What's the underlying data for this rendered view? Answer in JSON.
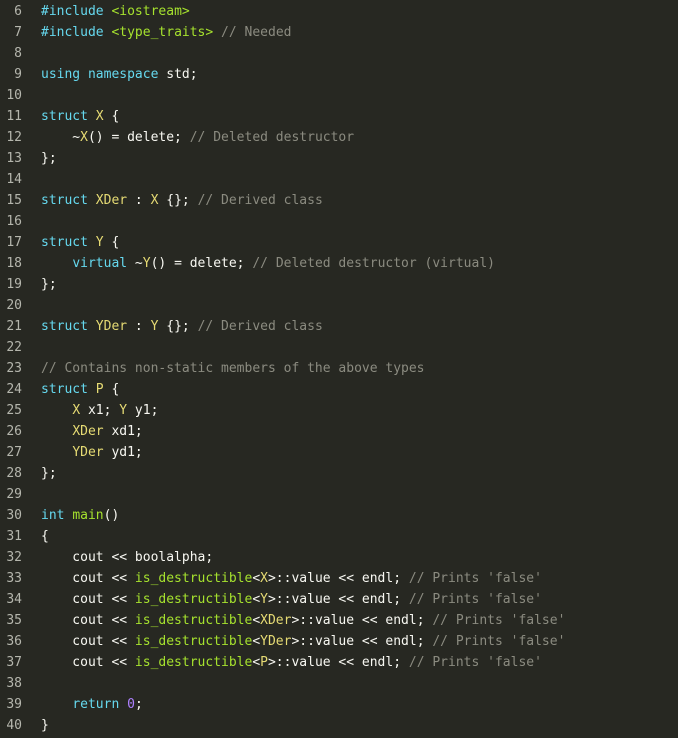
{
  "editor": {
    "lines": [
      {
        "num": "6",
        "tokens": [
          {
            "t": "#include ",
            "c": "pp"
          },
          {
            "t": "<iostream>",
            "c": "inc"
          }
        ]
      },
      {
        "num": "7",
        "tokens": [
          {
            "t": "#include ",
            "c": "pp"
          },
          {
            "t": "<type_traits>",
            "c": "inc"
          },
          {
            "t": " // Needed",
            "c": "cm"
          }
        ]
      },
      {
        "num": "8",
        "tokens": []
      },
      {
        "num": "9",
        "tokens": [
          {
            "t": "using",
            "c": "kw"
          },
          {
            "t": " ",
            "c": "pl"
          },
          {
            "t": "namespace",
            "c": "kw"
          },
          {
            "t": " std;",
            "c": "pl"
          }
        ]
      },
      {
        "num": "10",
        "tokens": []
      },
      {
        "num": "11",
        "tokens": [
          {
            "t": "struct",
            "c": "kw"
          },
          {
            "t": " ",
            "c": "pl"
          },
          {
            "t": "X",
            "c": "cls"
          },
          {
            "t": " {",
            "c": "pl"
          }
        ]
      },
      {
        "num": "12",
        "tokens": [
          {
            "t": "    ~",
            "c": "pl"
          },
          {
            "t": "X",
            "c": "cls"
          },
          {
            "t": "() = delete; ",
            "c": "pl"
          },
          {
            "t": "// Deleted destructor",
            "c": "cm"
          }
        ]
      },
      {
        "num": "13",
        "tokens": [
          {
            "t": "};",
            "c": "pl"
          }
        ]
      },
      {
        "num": "14",
        "tokens": []
      },
      {
        "num": "15",
        "tokens": [
          {
            "t": "struct",
            "c": "kw"
          },
          {
            "t": " ",
            "c": "pl"
          },
          {
            "t": "XDer",
            "c": "cls"
          },
          {
            "t": " : ",
            "c": "pl"
          },
          {
            "t": "X",
            "c": "cls"
          },
          {
            "t": " {}; ",
            "c": "pl"
          },
          {
            "t": "// Derived class",
            "c": "cm"
          }
        ]
      },
      {
        "num": "16",
        "tokens": []
      },
      {
        "num": "17",
        "tokens": [
          {
            "t": "struct",
            "c": "kw"
          },
          {
            "t": " ",
            "c": "pl"
          },
          {
            "t": "Y",
            "c": "cls"
          },
          {
            "t": " {",
            "c": "pl"
          }
        ]
      },
      {
        "num": "18",
        "tokens": [
          {
            "t": "    ",
            "c": "pl"
          },
          {
            "t": "virtual",
            "c": "kw"
          },
          {
            "t": " ~",
            "c": "pl"
          },
          {
            "t": "Y",
            "c": "cls"
          },
          {
            "t": "() = delete; ",
            "c": "pl"
          },
          {
            "t": "// Deleted destructor (virtual)",
            "c": "cm"
          }
        ]
      },
      {
        "num": "19",
        "tokens": [
          {
            "t": "};",
            "c": "pl"
          }
        ]
      },
      {
        "num": "20",
        "tokens": []
      },
      {
        "num": "21",
        "tokens": [
          {
            "t": "struct",
            "c": "kw"
          },
          {
            "t": " ",
            "c": "pl"
          },
          {
            "t": "YDer",
            "c": "cls"
          },
          {
            "t": " : ",
            "c": "pl"
          },
          {
            "t": "Y",
            "c": "cls"
          },
          {
            "t": " {}; ",
            "c": "pl"
          },
          {
            "t": "// Derived class",
            "c": "cm"
          }
        ]
      },
      {
        "num": "22",
        "tokens": []
      },
      {
        "num": "23",
        "tokens": [
          {
            "t": "// Contains non-static members of the above types",
            "c": "cm"
          }
        ]
      },
      {
        "num": "24",
        "tokens": [
          {
            "t": "struct",
            "c": "kw"
          },
          {
            "t": " ",
            "c": "pl"
          },
          {
            "t": "P",
            "c": "cls"
          },
          {
            "t": " {",
            "c": "pl"
          }
        ]
      },
      {
        "num": "25",
        "tokens": [
          {
            "t": "    ",
            "c": "pl"
          },
          {
            "t": "X",
            "c": "cls"
          },
          {
            "t": " x1; ",
            "c": "pl"
          },
          {
            "t": "Y",
            "c": "cls"
          },
          {
            "t": " y1;",
            "c": "pl"
          }
        ]
      },
      {
        "num": "26",
        "tokens": [
          {
            "t": "    ",
            "c": "pl"
          },
          {
            "t": "XDer",
            "c": "cls"
          },
          {
            "t": " xd1;",
            "c": "pl"
          }
        ]
      },
      {
        "num": "27",
        "tokens": [
          {
            "t": "    ",
            "c": "pl"
          },
          {
            "t": "YDer",
            "c": "cls"
          },
          {
            "t": " yd1;",
            "c": "pl"
          }
        ]
      },
      {
        "num": "28",
        "tokens": [
          {
            "t": "};",
            "c": "pl"
          }
        ]
      },
      {
        "num": "29",
        "tokens": []
      },
      {
        "num": "30",
        "tokens": [
          {
            "t": "int",
            "c": "kw"
          },
          {
            "t": " ",
            "c": "pl"
          },
          {
            "t": "main",
            "c": "fn"
          },
          {
            "t": "()",
            "c": "pl"
          }
        ]
      },
      {
        "num": "31",
        "tokens": [
          {
            "t": "{",
            "c": "pl"
          }
        ]
      },
      {
        "num": "32",
        "tokens": [
          {
            "t": "    cout << boolalpha;",
            "c": "pl"
          }
        ]
      },
      {
        "num": "33",
        "tokens": [
          {
            "t": "    cout << ",
            "c": "pl"
          },
          {
            "t": "is_destructible",
            "c": "fn"
          },
          {
            "t": "<",
            "c": "pl"
          },
          {
            "t": "X",
            "c": "cls"
          },
          {
            "t": ">::value << endl; ",
            "c": "pl"
          },
          {
            "t": "// Prints 'false'",
            "c": "cm"
          }
        ]
      },
      {
        "num": "34",
        "tokens": [
          {
            "t": "    cout << ",
            "c": "pl"
          },
          {
            "t": "is_destructible",
            "c": "fn"
          },
          {
            "t": "<",
            "c": "pl"
          },
          {
            "t": "Y",
            "c": "cls"
          },
          {
            "t": ">::value << endl; ",
            "c": "pl"
          },
          {
            "t": "// Prints 'false'",
            "c": "cm"
          }
        ]
      },
      {
        "num": "35",
        "tokens": [
          {
            "t": "    cout << ",
            "c": "pl"
          },
          {
            "t": "is_destructible",
            "c": "fn"
          },
          {
            "t": "<",
            "c": "pl"
          },
          {
            "t": "XDer",
            "c": "cls"
          },
          {
            "t": ">::value << endl; ",
            "c": "pl"
          },
          {
            "t": "// Prints 'false'",
            "c": "cm"
          }
        ]
      },
      {
        "num": "36",
        "tokens": [
          {
            "t": "    cout << ",
            "c": "pl"
          },
          {
            "t": "is_destructible",
            "c": "fn"
          },
          {
            "t": "<",
            "c": "pl"
          },
          {
            "t": "YDer",
            "c": "cls"
          },
          {
            "t": ">::value << endl; ",
            "c": "pl"
          },
          {
            "t": "// Prints 'false'",
            "c": "cm"
          }
        ]
      },
      {
        "num": "37",
        "tokens": [
          {
            "t": "    cout << ",
            "c": "pl"
          },
          {
            "t": "is_destructible",
            "c": "fn"
          },
          {
            "t": "<",
            "c": "pl"
          },
          {
            "t": "P",
            "c": "cls"
          },
          {
            "t": ">::value << endl; ",
            "c": "pl"
          },
          {
            "t": "// Prints 'false'",
            "c": "cm"
          }
        ]
      },
      {
        "num": "38",
        "tokens": []
      },
      {
        "num": "39",
        "tokens": [
          {
            "t": "    ",
            "c": "pl"
          },
          {
            "t": "return",
            "c": "kw"
          },
          {
            "t": " ",
            "c": "pl"
          },
          {
            "t": "0",
            "c": "num"
          },
          {
            "t": ";",
            "c": "pl"
          }
        ]
      },
      {
        "num": "40",
        "tokens": [
          {
            "t": "}",
            "c": "pl"
          }
        ]
      }
    ]
  },
  "colors": {
    "background": "#272822",
    "keyword": "#66d9ef",
    "include": "#a6e22e",
    "comment": "#8b8b80",
    "class_name": "#e6db74",
    "function": "#a6e22e",
    "number": "#ae81ff",
    "plain": "#f8f8f2",
    "gutter": "#b5b6ad"
  }
}
